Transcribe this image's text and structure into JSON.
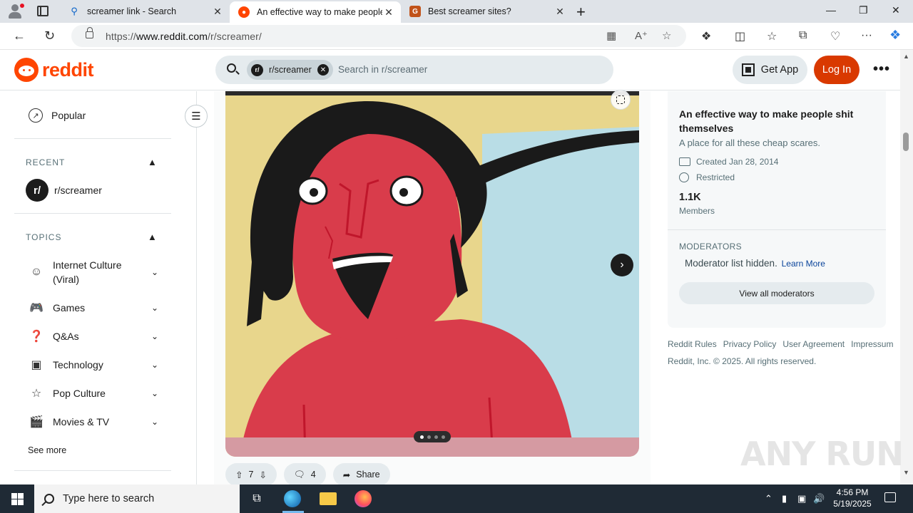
{
  "browser": {
    "tabs": [
      {
        "title": "screamer link - Search",
        "active": false
      },
      {
        "title": "An effective way to make people",
        "active": true
      },
      {
        "title": "Best screamer sites?",
        "active": false
      }
    ],
    "url_prefix": "https://",
    "url_host": "www.reddit.com",
    "url_path": "/r/screamer/"
  },
  "header": {
    "logo_text": "reddit",
    "search_chip": "r/screamer",
    "search_chip_badge": "r/",
    "search_placeholder": "Search in r/screamer",
    "get_app": "Get App",
    "login": "Log In",
    "more": "•••"
  },
  "sidebar": {
    "popular": "Popular",
    "recent_heading": "RECENT",
    "recent_item": "r/screamer",
    "recent_badge": "r/",
    "topics_heading": "TOPICS",
    "topics": [
      {
        "label": "Internet Culture (Viral)",
        "icon": "smile-icon"
      },
      {
        "label": "Games",
        "icon": "gamepad-icon"
      },
      {
        "label": "Q&As",
        "icon": "question-icon"
      },
      {
        "label": "Technology",
        "icon": "chip-icon"
      },
      {
        "label": "Pop Culture",
        "icon": "star-icon"
      },
      {
        "label": "Movies & TV",
        "icon": "clapperboard-icon"
      }
    ],
    "see_more": "See more"
  },
  "post": {
    "gallery_total": 4,
    "gallery_current": 1,
    "upvotes": "7",
    "comments": "4",
    "share": "Share"
  },
  "community": {
    "title": "An effective way to make people shit themselves",
    "description": "A place for all these cheap scares.",
    "created": "Created Jan 28, 2014",
    "restricted": "Restricted",
    "members_count": "1.1K",
    "members_label": "Members",
    "moderators_heading": "MODERATORS",
    "moderators_text": "Moderator list hidden.",
    "learn_more": "Learn More",
    "view_mods": "View all moderators"
  },
  "footer": {
    "links": [
      "Reddit Rules",
      "Privacy Policy",
      "User Agreement",
      "Impressum"
    ],
    "copyright": "Reddit, Inc. © 2025. All rights reserved."
  },
  "watermark": "ANY RUN",
  "taskbar": {
    "search_placeholder": "Type here to search",
    "time": "4:56 PM",
    "date": "5/19/2025"
  },
  "colors": {
    "brand": "#ff4500",
    "login_bg": "#d93900",
    "link": "#0a449b"
  }
}
